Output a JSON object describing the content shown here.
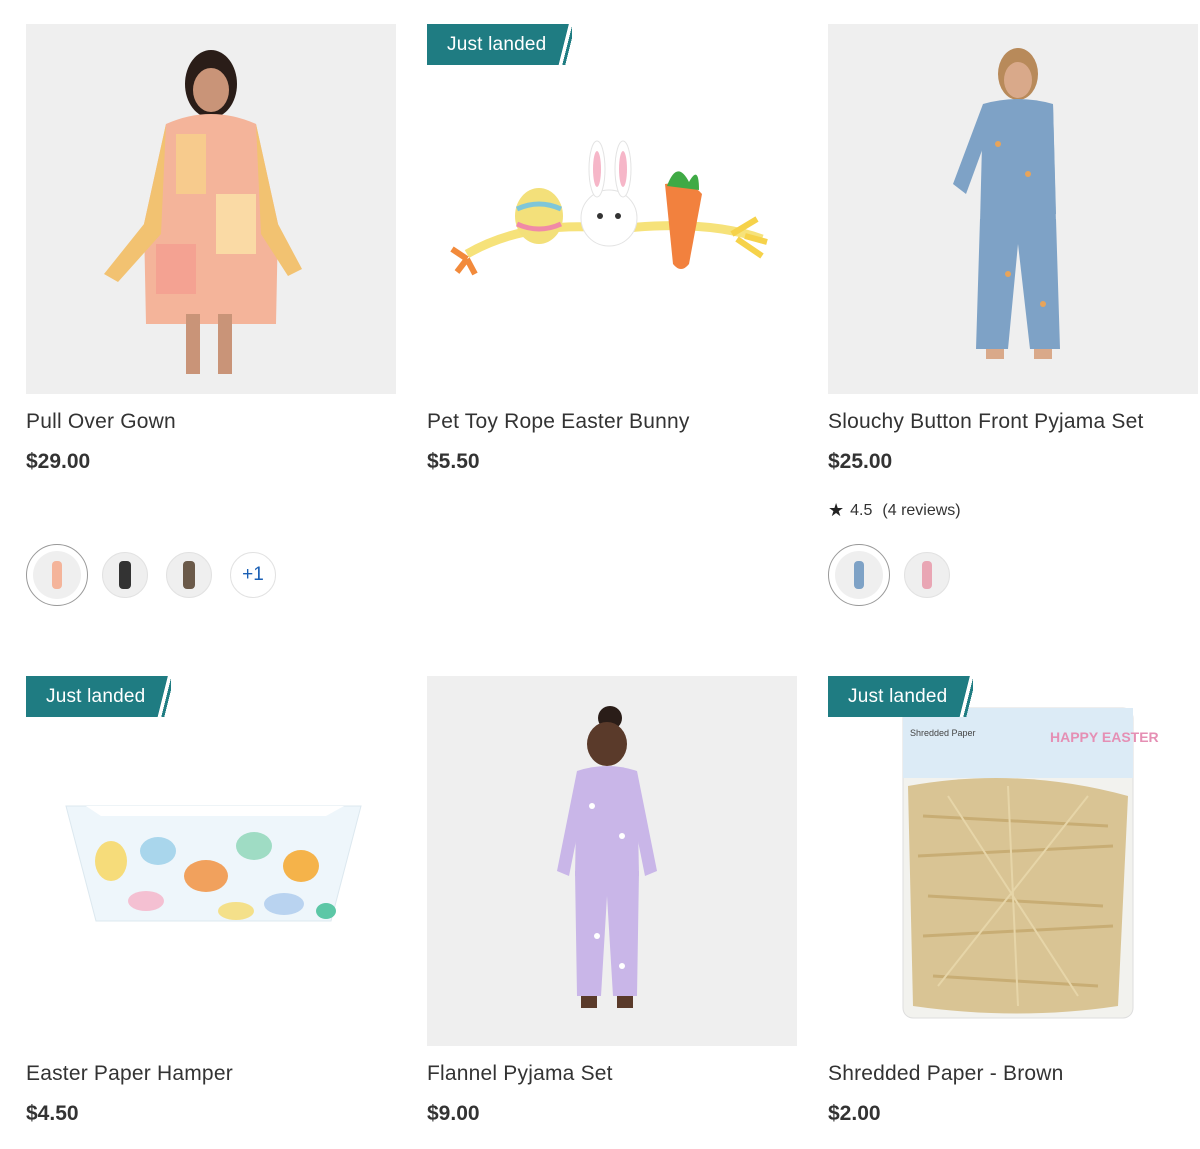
{
  "products": [
    {
      "name": "Pull Over Gown",
      "price": "$29.00",
      "image_icon": "woman-in-pink-plaid-hooded-gown",
      "swatch_more": "+1"
    },
    {
      "badge": "Just landed",
      "name": "Pet Toy Rope Easter Bunny",
      "price": "$5.50",
      "image_icon": "rope-toy-with-egg-bunny-carrot"
    },
    {
      "name": "Slouchy Button Front Pyjama Set",
      "price": "$25.00",
      "rating": "4.5",
      "reviews": "(4 reviews)",
      "image_icon": "woman-in-blue-pyjama-set"
    },
    {
      "badge": "Just landed",
      "name": "Easter Paper Hamper",
      "price": "$4.50",
      "image_icon": "easter-egg-print-basket"
    },
    {
      "name": "Flannel Pyjama Set",
      "price": "$9.00",
      "image_icon": "child-in-purple-pyjamas"
    },
    {
      "badge": "Just landed",
      "name": "Shredded Paper - Brown",
      "price": "$2.00",
      "image_icon": "bag-of-shredded-paper",
      "pack_label": "Shredded Paper",
      "pack_brand": "HAPPY EASTER"
    }
  ],
  "colors": {
    "badge": "#1f7c82",
    "text": "#333333",
    "link": "#1a5fb4",
    "image_bg": "#efefef"
  }
}
